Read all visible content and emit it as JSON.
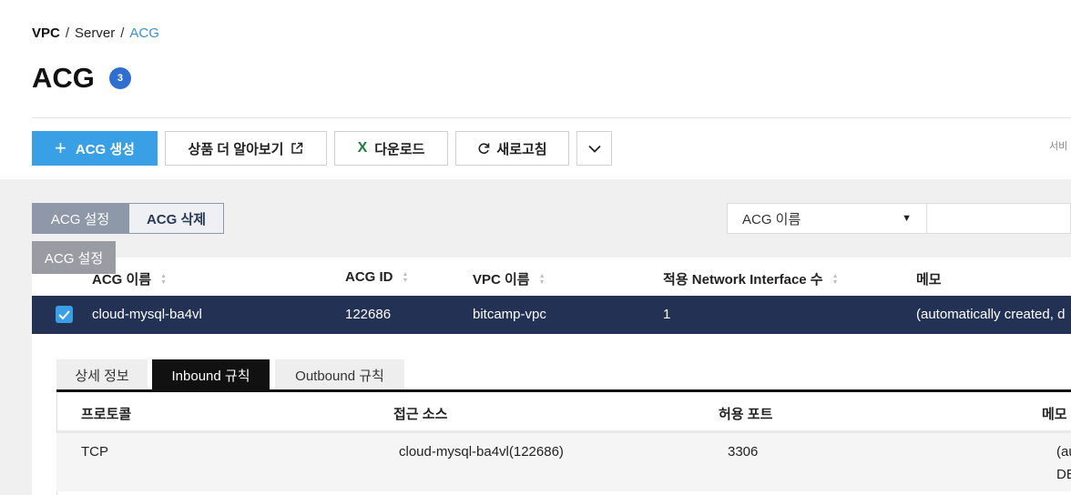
{
  "breadcrumb": {
    "items": [
      "VPC",
      "Server",
      "ACG"
    ],
    "sep": "/"
  },
  "page": {
    "title": "ACG",
    "count": "3"
  },
  "toolbar": {
    "create": "ACG 생성",
    "learn_more": "상품 더 알아보기",
    "download": "다운로드",
    "refresh": "새로고침",
    "service_hint": "서비"
  },
  "actions": {
    "settings": "ACG 설정",
    "delete": "ACG 삭제",
    "tooltip": "ACG 설정"
  },
  "filter": {
    "selected": "ACG 이름"
  },
  "table": {
    "columns": [
      "ACG 이름",
      "ACG ID",
      "VPC 이름",
      "적용 Network Interface 수",
      "메모"
    ],
    "rows": [
      {
        "name": "cloud-mysql-ba4vl",
        "id": "122686",
        "vpc": "bitcamp-vpc",
        "nic": "1",
        "memo": "(automatically created, d"
      }
    ]
  },
  "detail": {
    "tabs": [
      "상세 정보",
      "Inbound 규칙",
      "Outbound 규칙"
    ],
    "active_tab": "Inbound 규칙",
    "columns": [
      "프로토콜",
      "접근 소스",
      "허용 포트",
      "메모"
    ],
    "rows": [
      {
        "protocol": "TCP",
        "source": "cloud-mysql-ba4vl(122686)",
        "port": "3306",
        "memo_line1": "(au",
        "memo_line2": "DE"
      }
    ]
  },
  "colors": {
    "primary": "#3aa0e5",
    "selected_row": "#233154",
    "badge": "#2f6fd0",
    "excel_green": "#1e7c3e"
  }
}
